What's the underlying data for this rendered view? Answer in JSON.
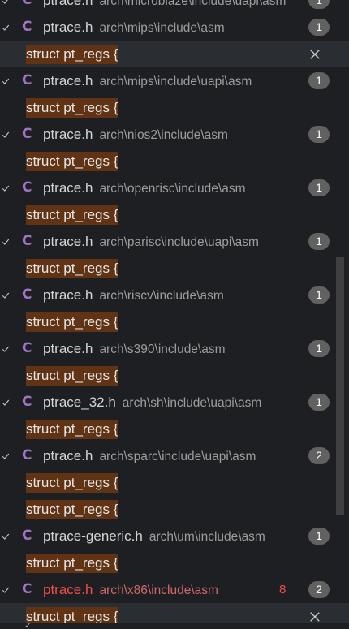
{
  "results": [
    {
      "type": "file",
      "name": "ptrace.h",
      "path": "arch\\microblaze\\include\\uapi\\asm",
      "count": "1"
    },
    {
      "type": "file",
      "name": "ptrace.h",
      "path": "arch\\mips\\include\\asm",
      "count": "1"
    },
    {
      "type": "match",
      "text": "struct pt_regs {",
      "selected": true
    },
    {
      "type": "file",
      "name": "ptrace.h",
      "path": "arch\\mips\\include\\uapi\\asm",
      "count": "1"
    },
    {
      "type": "match",
      "text": "struct pt_regs {"
    },
    {
      "type": "file",
      "name": "ptrace.h",
      "path": "arch\\nios2\\include\\asm",
      "count": "1"
    },
    {
      "type": "match",
      "text": "struct pt_regs {"
    },
    {
      "type": "file",
      "name": "ptrace.h",
      "path": "arch\\openrisc\\include\\asm",
      "count": "1"
    },
    {
      "type": "match",
      "text": "struct pt_regs {"
    },
    {
      "type": "file",
      "name": "ptrace.h",
      "path": "arch\\parisc\\include\\uapi\\asm",
      "count": "1"
    },
    {
      "type": "match",
      "text": "struct pt_regs {"
    },
    {
      "type": "file",
      "name": "ptrace.h",
      "path": "arch\\riscv\\include\\asm",
      "count": "1"
    },
    {
      "type": "match",
      "text": "struct pt_regs {"
    },
    {
      "type": "file",
      "name": "ptrace.h",
      "path": "arch\\s390\\include\\asm",
      "count": "1"
    },
    {
      "type": "match",
      "text": "struct pt_regs {"
    },
    {
      "type": "file",
      "name": "ptrace_32.h",
      "path": "arch\\sh\\include\\uapi\\asm",
      "count": "1"
    },
    {
      "type": "match",
      "text": "struct pt_regs {"
    },
    {
      "type": "file",
      "name": "ptrace.h",
      "path": "arch\\sparc\\include\\uapi\\asm",
      "count": "2"
    },
    {
      "type": "match",
      "text": "struct pt_regs {"
    },
    {
      "type": "match",
      "text": "struct pt_regs {"
    },
    {
      "type": "file",
      "name": "ptrace-generic.h",
      "path": "arch\\um\\include\\asm",
      "count": "1"
    },
    {
      "type": "match",
      "text": "struct pt_regs {"
    },
    {
      "type": "file",
      "name": "ptrace.h",
      "path": "arch\\x86\\include\\asm",
      "count": "2",
      "error": true,
      "errors": "8"
    },
    {
      "type": "match",
      "text": "struct pt_regs {",
      "selected": true
    }
  ],
  "icons": {
    "file_icon": "C",
    "expand": "chevron-down-icon",
    "dismiss": "close-icon"
  },
  "colors": {
    "background": "#1e1f22",
    "match_highlight": "#613315",
    "c_icon": "#a074c4",
    "error": "#f14c4c",
    "badge": "#616161"
  }
}
